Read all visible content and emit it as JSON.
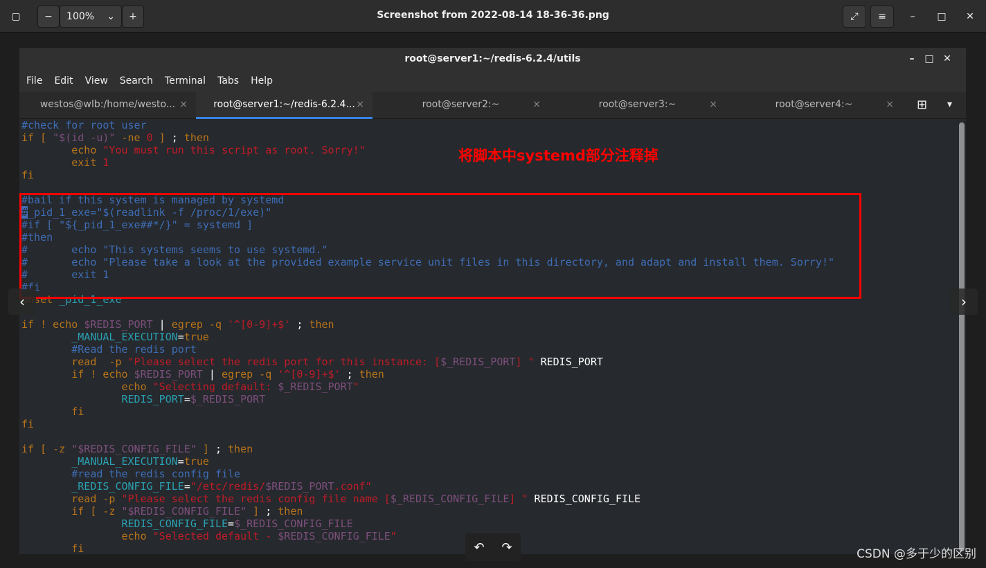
{
  "viewer": {
    "title": "Screenshot from 2022-08-14 18-36-36.png",
    "zoom": "100%",
    "zoom_out": "−",
    "zoom_in": "+",
    "chevron": "⌄",
    "fullscreen": "⤢",
    "menu": "≡",
    "minimize": "–",
    "maximize": "□",
    "close": "✕"
  },
  "terminal": {
    "title": "root@server1:~/redis-6.2.4/utils",
    "minimize": "–",
    "maximize": "□",
    "close": "✕",
    "menu": [
      "File",
      "Edit",
      "View",
      "Search",
      "Terminal",
      "Tabs",
      "Help"
    ],
    "tabs": [
      {
        "label": "westos@wlb:/home/westo..."
      },
      {
        "label": "root@server1:~/redis-6.2.4..."
      },
      {
        "label": "root@server2:~"
      },
      {
        "label": "root@server3:~"
      },
      {
        "label": "root@server4:~"
      }
    ],
    "tab_close": "×",
    "new_tab": "⊞",
    "tab_menu": "▾",
    "lines": [
      [
        [
          "#check for root user",
          "c"
        ]
      ],
      [
        [
          "if [ ",
          "k"
        ],
        [
          "\"$(id -u)\"",
          "v"
        ],
        [
          " -ne ",
          "k"
        ],
        [
          "0",
          "s"
        ],
        [
          " ]",
          "k"
        ],
        [
          " ; ",
          "w"
        ],
        [
          "then",
          "k"
        ]
      ],
      [
        [
          "        echo ",
          "k"
        ],
        [
          "\"You must run this script as root. Sorry!\"",
          "s"
        ]
      ],
      [
        [
          "        exit ",
          "k"
        ],
        [
          "1",
          "s"
        ]
      ],
      [
        [
          "fi",
          "k"
        ]
      ],
      [],
      [
        [
          "#bail if this system is managed by systemd",
          "c"
        ]
      ],
      [
        [
          "#",
          "cursor"
        ],
        [
          "_pid_1_exe=\"$(readlink -f /proc/1/exe)\"",
          "c"
        ]
      ],
      [
        [
          "#if [ \"${_pid_1_exe##*/}\" = systemd ]",
          "c"
        ]
      ],
      [
        [
          "#then",
          "c"
        ]
      ],
      [
        [
          "#       echo \"This systems seems to use systemd.\"",
          "c"
        ]
      ],
      [
        [
          "#       echo \"Please take a look at the provided example service unit files in this directory, and adapt and install them. Sorry!\"",
          "c"
        ]
      ],
      [
        [
          "#       exit 1",
          "c"
        ]
      ],
      [
        [
          "#fi",
          "c"
        ]
      ],
      [
        [
          "unset ",
          "k"
        ],
        [
          "_pid_1_exe",
          "t"
        ]
      ],
      [],
      [
        [
          "if ! echo ",
          "k"
        ],
        [
          "$REDIS_PORT",
          "v"
        ],
        [
          " | ",
          "w"
        ],
        [
          "egrep -q ",
          "k"
        ],
        [
          "'^[0-9]+$'",
          "s"
        ],
        [
          " ; ",
          "w"
        ],
        [
          "then",
          "k"
        ]
      ],
      [
        [
          "        ",
          ""
        ],
        [
          "_MANUAL_EXECUTION",
          "t"
        ],
        [
          "=",
          "w"
        ],
        [
          "true",
          "k"
        ]
      ],
      [
        [
          "        #Read the redis port",
          "c"
        ]
      ],
      [
        [
          "        read  -p ",
          "k"
        ],
        [
          "\"Please select the redis port for this instance: [",
          "s"
        ],
        [
          "$_REDIS_PORT",
          "v"
        ],
        [
          "] \"",
          "s"
        ],
        [
          " REDIS_PORT",
          "w"
        ]
      ],
      [
        [
          "        if ! echo ",
          "k"
        ],
        [
          "$REDIS_PORT",
          "v"
        ],
        [
          " | ",
          "w"
        ],
        [
          "egrep -q ",
          "k"
        ],
        [
          "'^[0-9]+$'",
          "s"
        ],
        [
          " ; ",
          "w"
        ],
        [
          "then",
          "k"
        ]
      ],
      [
        [
          "                echo ",
          "k"
        ],
        [
          "\"Selecting default: ",
          "s"
        ],
        [
          "$_REDIS_PORT",
          "v"
        ],
        [
          "\"",
          "s"
        ]
      ],
      [
        [
          "                ",
          ""
        ],
        [
          "REDIS_PORT",
          "t"
        ],
        [
          "=",
          "w"
        ],
        [
          "$_REDIS_PORT",
          "v"
        ]
      ],
      [
        [
          "        fi",
          "k"
        ]
      ],
      [
        [
          "fi",
          "k"
        ]
      ],
      [],
      [
        [
          "if [ -z ",
          "k"
        ],
        [
          "\"$REDIS_CONFIG_FILE\"",
          "v"
        ],
        [
          " ] ",
          "k"
        ],
        [
          "; ",
          "w"
        ],
        [
          "then",
          "k"
        ]
      ],
      [
        [
          "        ",
          ""
        ],
        [
          "_MANUAL_EXECUTION",
          "t"
        ],
        [
          "=",
          "w"
        ],
        [
          "true",
          "k"
        ]
      ],
      [
        [
          "        #read the redis config file",
          "c"
        ]
      ],
      [
        [
          "        ",
          ""
        ],
        [
          "_REDIS_CONFIG_FILE",
          "t"
        ],
        [
          "=",
          "w"
        ],
        [
          "\"/etc/redis/",
          "s"
        ],
        [
          "$REDIS_PORT",
          "v"
        ],
        [
          ".conf\"",
          "s"
        ]
      ],
      [
        [
          "        read -p ",
          "k"
        ],
        [
          "\"Please select the redis config file name [",
          "s"
        ],
        [
          "$_REDIS_CONFIG_FILE",
          "v"
        ],
        [
          "] \"",
          "s"
        ],
        [
          " REDIS_CONFIG_FILE",
          "w"
        ]
      ],
      [
        [
          "        if [ -z ",
          "k"
        ],
        [
          "\"$REDIS_CONFIG_FILE\"",
          "v"
        ],
        [
          " ] ",
          "k"
        ],
        [
          "; ",
          "w"
        ],
        [
          "then",
          "k"
        ]
      ],
      [
        [
          "                ",
          ""
        ],
        [
          "REDIS_CONFIG_FILE",
          "t"
        ],
        [
          "=",
          "w"
        ],
        [
          "$_REDIS_CONFIG_FILE",
          "v"
        ]
      ],
      [
        [
          "                echo ",
          "k"
        ],
        [
          "\"Selected default - ",
          "s"
        ],
        [
          "$REDIS_CONFIG_FILE",
          "v"
        ],
        [
          "\"",
          "s"
        ]
      ],
      [
        [
          "        fi",
          "k"
        ]
      ]
    ]
  },
  "annotation": "将脚本中systemd部分注释掉",
  "nav": {
    "prev": "‹",
    "next": "›"
  },
  "rotate": {
    "left": "↶",
    "right": "↷"
  },
  "watermark": "CSDN @多于少的区别",
  "colors": {
    "keyword": "#b8741a",
    "comment": "#3e6db6",
    "string": "#c01c28",
    "variable": "#7d4f7d",
    "identifier": "#2aa1b3",
    "highlight": "#ff0000",
    "tab_accent": "#3584e4"
  }
}
